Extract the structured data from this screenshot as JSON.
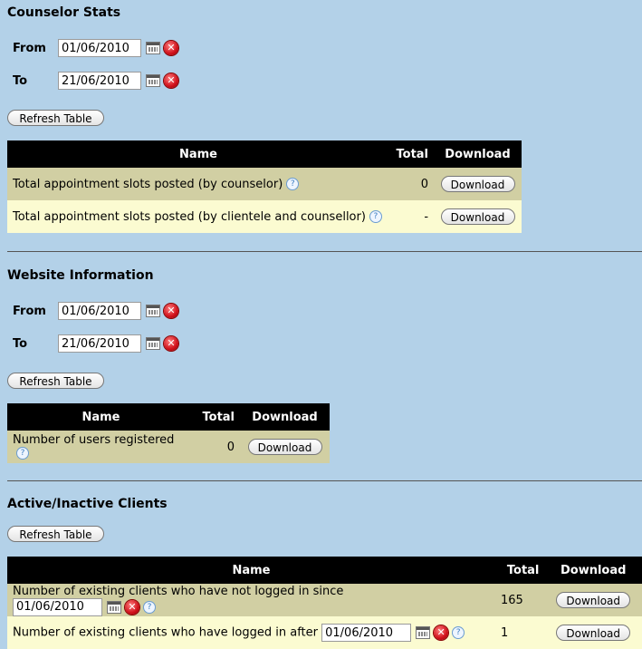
{
  "counselor": {
    "title": "Counselor Stats",
    "from_label": "From",
    "from_value": "01/06/2010",
    "to_label": "To",
    "to_value": "21/06/2010",
    "refresh_label": "Refresh Table",
    "headers": {
      "name": "Name",
      "total": "Total",
      "download": "Download"
    },
    "rows": [
      {
        "name": "Total appointment slots posted (by counselor)",
        "total": "0",
        "download": "Download"
      },
      {
        "name": "Total appointment slots posted (by clientele and counsellor)",
        "total": "-",
        "download": "Download"
      }
    ]
  },
  "website": {
    "title": "Website Information",
    "from_label": "From",
    "from_value": "01/06/2010",
    "to_label": "To",
    "to_value": "21/06/2010",
    "refresh_label": "Refresh Table",
    "headers": {
      "name": "Name",
      "total": "Total",
      "download": "Download"
    },
    "rows": [
      {
        "name": "Number of users registered",
        "total": "0",
        "download": "Download"
      }
    ]
  },
  "active": {
    "title": "Active/Inactive Clients",
    "refresh_label": "Refresh Table",
    "headers": {
      "name": "Name",
      "total": "Total",
      "download": "Download"
    },
    "rows": [
      {
        "name": "Number of existing clients who have not logged in since",
        "date": "01/06/2010",
        "total": "165",
        "download": "Download"
      },
      {
        "name": "Number of existing clients who have logged in after",
        "date": "01/06/2010",
        "total": "1",
        "download": "Download"
      }
    ]
  },
  "icons": {
    "help": "?",
    "clear": "✕"
  }
}
